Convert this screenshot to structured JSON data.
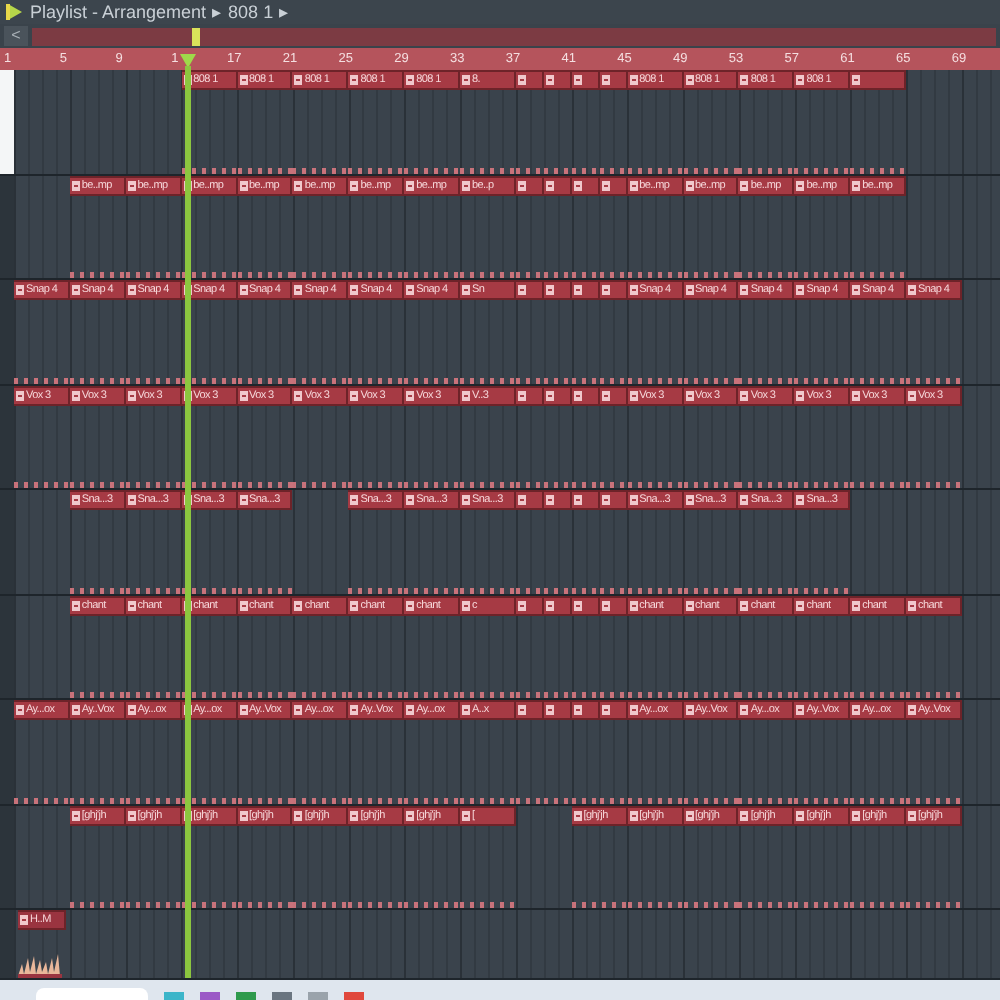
{
  "title_bar": {
    "title": "Playlist - Arrangement",
    "separator_1": "▸",
    "pattern": "808 1",
    "separator_2": "▸"
  },
  "overview": {
    "back_button": "<"
  },
  "ruler": {
    "marks": [
      "1",
      "5",
      "9",
      "1",
      "17",
      "21",
      "25",
      "29",
      "33",
      "37",
      "41",
      "45",
      "49",
      "53",
      "57",
      "61",
      "65",
      "69"
    ]
  },
  "playhead": {
    "level": 0.174
  },
  "tracks": [
    {
      "selected": true,
      "clips": [
        {
          "kind": "gap"
        },
        {
          "kind": "gap"
        },
        {
          "kind": "gap"
        },
        {
          "kind": "pattern",
          "label": "808 1"
        },
        {
          "kind": "pattern",
          "label": "808 1"
        },
        {
          "kind": "pattern",
          "label": "808 1"
        },
        {
          "kind": "pattern",
          "label": "808 1"
        },
        {
          "kind": "pattern",
          "label": "808 1"
        },
        {
          "kind": "pattern",
          "label": "8."
        },
        {
          "kind": "short"
        },
        {
          "kind": "short"
        },
        {
          "kind": "short"
        },
        {
          "kind": "short"
        },
        {
          "kind": "pattern",
          "label": "808 1"
        },
        {
          "kind": "pattern",
          "label": "808 1"
        },
        {
          "kind": "pattern",
          "label": "808 1"
        },
        {
          "kind": "pattern",
          "label": "808 1"
        },
        {
          "kind": "blank"
        }
      ]
    },
    {
      "selected": false,
      "clips": [
        {
          "kind": "gap"
        },
        {
          "kind": "pattern",
          "label": "be..mp"
        },
        {
          "kind": "pattern",
          "label": "be..mp"
        },
        {
          "kind": "pattern",
          "label": "be..mp"
        },
        {
          "kind": "pattern",
          "label": "be..mp"
        },
        {
          "kind": "pattern",
          "label": "be..mp"
        },
        {
          "kind": "pattern",
          "label": "be..mp"
        },
        {
          "kind": "pattern",
          "label": "be..mp"
        },
        {
          "kind": "pattern",
          "label": "be..p"
        },
        {
          "kind": "short"
        },
        {
          "kind": "short"
        },
        {
          "kind": "short"
        },
        {
          "kind": "short"
        },
        {
          "kind": "pattern",
          "label": "be..mp"
        },
        {
          "kind": "pattern",
          "label": "be..mp"
        },
        {
          "kind": "pattern",
          "label": "be..mp"
        },
        {
          "kind": "pattern",
          "label": "be..mp"
        },
        {
          "kind": "pattern",
          "label": "be..mp"
        }
      ]
    },
    {
      "selected": false,
      "clips": [
        {
          "kind": "pattern",
          "label": "Snap 4"
        },
        {
          "kind": "pattern",
          "label": "Snap 4"
        },
        {
          "kind": "pattern",
          "label": "Snap 4"
        },
        {
          "kind": "pattern",
          "label": "Snap 4"
        },
        {
          "kind": "pattern",
          "label": "Snap 4"
        },
        {
          "kind": "pattern",
          "label": "Snap 4"
        },
        {
          "kind": "pattern",
          "label": "Snap 4"
        },
        {
          "kind": "pattern",
          "label": "Snap 4"
        },
        {
          "kind": "pattern",
          "label": "Sn"
        },
        {
          "kind": "short"
        },
        {
          "kind": "short"
        },
        {
          "kind": "short"
        },
        {
          "kind": "short"
        },
        {
          "kind": "pattern",
          "label": "Snap 4"
        },
        {
          "kind": "pattern",
          "label": "Snap 4"
        },
        {
          "kind": "pattern",
          "label": "Snap 4"
        },
        {
          "kind": "pattern",
          "label": "Snap 4"
        },
        {
          "kind": "pattern",
          "label": "Snap 4"
        },
        {
          "kind": "pattern",
          "label": "Snap 4"
        }
      ]
    },
    {
      "selected": false,
      "clips": [
        {
          "kind": "pattern",
          "label": "Vox 3"
        },
        {
          "kind": "pattern",
          "label": "Vox 3"
        },
        {
          "kind": "pattern",
          "label": "Vox 3"
        },
        {
          "kind": "pattern",
          "label": "Vox 3"
        },
        {
          "kind": "pattern",
          "label": "Vox 3"
        },
        {
          "kind": "pattern",
          "label": "Vox 3"
        },
        {
          "kind": "pattern",
          "label": "Vox 3"
        },
        {
          "kind": "pattern",
          "label": "Vox 3"
        },
        {
          "kind": "pattern",
          "label": "V..3"
        },
        {
          "kind": "short"
        },
        {
          "kind": "short"
        },
        {
          "kind": "short"
        },
        {
          "kind": "short"
        },
        {
          "kind": "pattern",
          "label": "Vox 3"
        },
        {
          "kind": "pattern",
          "label": "Vox 3"
        },
        {
          "kind": "pattern",
          "label": "Vox 3"
        },
        {
          "kind": "pattern",
          "label": "Vox 3"
        },
        {
          "kind": "pattern",
          "label": "Vox 3"
        },
        {
          "kind": "pattern",
          "label": "Vox 3"
        }
      ]
    },
    {
      "selected": false,
      "clips": [
        {
          "kind": "gap"
        },
        {
          "kind": "pattern",
          "label": "Sna...3"
        },
        {
          "kind": "pattern",
          "label": "Sna...3"
        },
        {
          "kind": "pattern",
          "label": "Sna...3"
        },
        {
          "kind": "pattern",
          "label": "Sna...3"
        },
        {
          "kind": "gap"
        },
        {
          "kind": "pattern",
          "label": "Sna...3"
        },
        {
          "kind": "pattern",
          "label": "Sna...3"
        },
        {
          "kind": "pattern",
          "label": "Sna...3"
        },
        {
          "kind": "short"
        },
        {
          "kind": "short"
        },
        {
          "kind": "short"
        },
        {
          "kind": "short"
        },
        {
          "kind": "pattern",
          "label": "Sna...3"
        },
        {
          "kind": "pattern",
          "label": "Sna...3"
        },
        {
          "kind": "pattern",
          "label": "Sna...3"
        },
        {
          "kind": "pattern",
          "label": "Sna...3"
        }
      ]
    },
    {
      "selected": false,
      "clips": [
        {
          "kind": "gap"
        },
        {
          "kind": "pattern",
          "label": "chant"
        },
        {
          "kind": "pattern",
          "label": "chant"
        },
        {
          "kind": "pattern",
          "label": "chant"
        },
        {
          "kind": "pattern",
          "label": "chant"
        },
        {
          "kind": "pattern",
          "label": "chant"
        },
        {
          "kind": "pattern",
          "label": "chant"
        },
        {
          "kind": "pattern",
          "label": "chant"
        },
        {
          "kind": "pattern",
          "label": "c"
        },
        {
          "kind": "short"
        },
        {
          "kind": "short"
        },
        {
          "kind": "short"
        },
        {
          "kind": "short"
        },
        {
          "kind": "pattern",
          "label": "chant"
        },
        {
          "kind": "pattern",
          "label": "chant"
        },
        {
          "kind": "pattern",
          "label": "chant"
        },
        {
          "kind": "pattern",
          "label": "chant"
        },
        {
          "kind": "pattern",
          "label": "chant"
        },
        {
          "kind": "pattern",
          "label": "chant"
        }
      ]
    },
    {
      "selected": false,
      "clips": [
        {
          "kind": "pattern",
          "label": "Ay...ox"
        },
        {
          "kind": "pattern",
          "label": "Ay..Vox"
        },
        {
          "kind": "pattern",
          "label": "Ay...ox"
        },
        {
          "kind": "pattern",
          "label": "Ay...ox"
        },
        {
          "kind": "pattern",
          "label": "Ay..Vox"
        },
        {
          "kind": "pattern",
          "label": "Ay...ox"
        },
        {
          "kind": "pattern",
          "label": "Ay..Vox"
        },
        {
          "kind": "pattern",
          "label": "Ay...ox"
        },
        {
          "kind": "pattern",
          "label": "A..x"
        },
        {
          "kind": "short"
        },
        {
          "kind": "short"
        },
        {
          "kind": "short"
        },
        {
          "kind": "short"
        },
        {
          "kind": "pattern",
          "label": "Ay...ox"
        },
        {
          "kind": "pattern",
          "label": "Ay..Vox"
        },
        {
          "kind": "pattern",
          "label": "Ay...ox"
        },
        {
          "kind": "pattern",
          "label": "Ay..Vox"
        },
        {
          "kind": "pattern",
          "label": "Ay...ox"
        },
        {
          "kind": "pattern",
          "label": "Ay..Vox"
        }
      ]
    },
    {
      "selected": false,
      "clips": [
        {
          "kind": "gap"
        },
        {
          "kind": "pattern",
          "label": "[ghj'jh"
        },
        {
          "kind": "pattern",
          "label": "[ghj'jh"
        },
        {
          "kind": "pattern",
          "label": "[ghj'jh"
        },
        {
          "kind": "pattern",
          "label": "[ghj'jh"
        },
        {
          "kind": "pattern",
          "label": "[ghj'jh"
        },
        {
          "kind": "pattern",
          "label": "[ghj'jh"
        },
        {
          "kind": "pattern",
          "label": "[ghj'jh"
        },
        {
          "kind": "pattern",
          "label": "["
        },
        {
          "kind": "gap"
        },
        {
          "kind": "pattern",
          "label": "[ghj'jh"
        },
        {
          "kind": "pattern",
          "label": "[ghj'jh"
        },
        {
          "kind": "pattern",
          "label": "[ghj'jh"
        },
        {
          "kind": "pattern",
          "label": "[ghj'jh"
        },
        {
          "kind": "pattern",
          "label": "[ghj'jh"
        },
        {
          "kind": "pattern",
          "label": "[ghj'jh"
        },
        {
          "kind": "pattern",
          "label": "[ghj'jh"
        }
      ]
    },
    {
      "selected": false,
      "clips": [
        {
          "kind": "audio",
          "label": "H..M"
        }
      ]
    }
  ]
}
